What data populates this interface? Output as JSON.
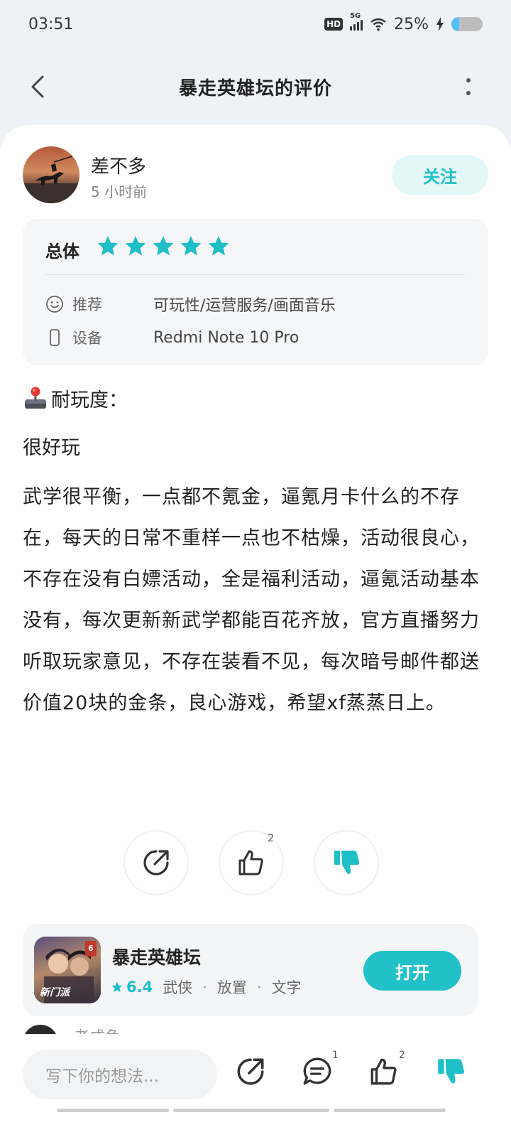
{
  "status_bar": {
    "time": "03:51",
    "network": "5G",
    "hd": "HD",
    "battery_text": "25%",
    "battery_level": 0.25
  },
  "header": {
    "title": "暴走英雄坛的评价",
    "back_icon": "chevron-left-icon",
    "more_icon": "more-vertical-icon"
  },
  "author": {
    "name": "差不多",
    "time": "5 小时前",
    "follow_label": "关注"
  },
  "rating": {
    "overall_label": "总体",
    "stars": 5,
    "recommend_label": "推荐",
    "recommend_value": "可玩性/运营服务/画面音乐",
    "device_label": "设备",
    "device_value": "Redmi Note 10 Pro"
  },
  "review": {
    "section_title": "耐玩度：",
    "short_line": "很好玩",
    "body": "武学很平衡，一点都不氪金，逼氪月卡什么的不存在，每天的日常不重样一点也不枯燥，活动很良心，不存在没有白嫖活动，全是福利活动，逼氪活动基本没有，每次更新新武学都能百花齐放，官方直播努力听取玩家意见，不存在装看不见，每次暗号邮件都送价值20块的金条，良心游戏，希望xf蒸蒸日上。"
  },
  "actions": {
    "like_count": "2"
  },
  "app": {
    "name": "暴走英雄坛",
    "score": "6.4",
    "tags": [
      "武侠",
      "放置",
      "文字"
    ],
    "open_label": "打开",
    "icon_badge": "6",
    "icon_text": "新门派"
  },
  "next_review": {
    "name": "老成龟"
  },
  "bottom_bar": {
    "input_placeholder": "写下你的想法...",
    "comment_count": "1",
    "like_count": "2"
  },
  "colors": {
    "accent": "#1fbfc8",
    "accent_bg": "#e3f7f7"
  }
}
